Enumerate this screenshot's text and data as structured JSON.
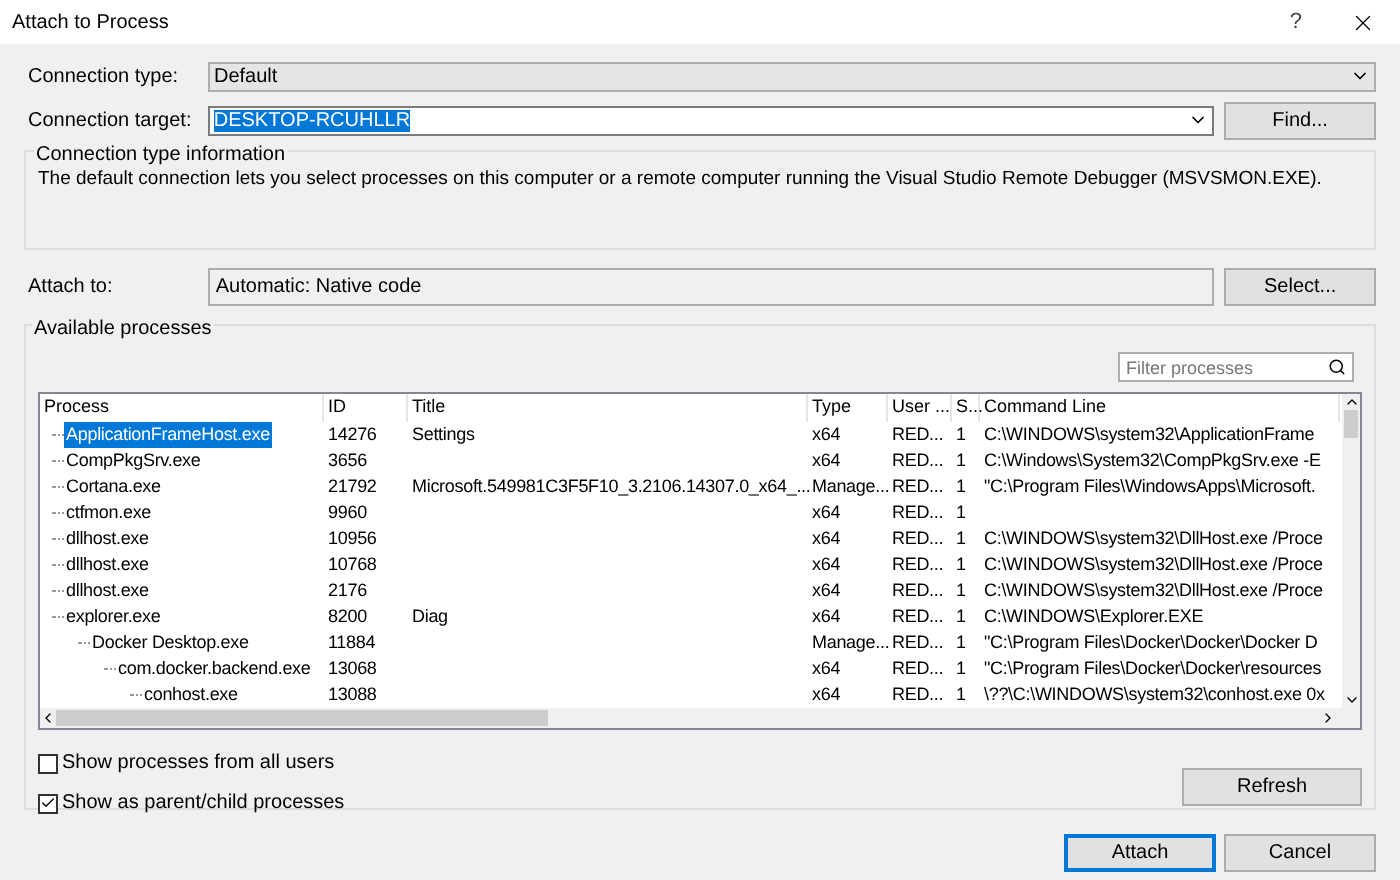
{
  "window": {
    "title": "Attach to Process",
    "help": "?"
  },
  "connection_type": {
    "label": "Connection type:",
    "value": "Default"
  },
  "connection_target": {
    "label": "Connection target:",
    "value": "DESKTOP-RCUHLLR",
    "text_selected": true,
    "button": "Find..."
  },
  "info": {
    "title": "Connection type information",
    "text": "The default connection lets you select processes on this computer or a remote computer running the Visual Studio Remote Debugger (MSVSMON.EXE)."
  },
  "attach_to": {
    "label": "Attach to:",
    "value": "Automatic: Native code",
    "button": "Select..."
  },
  "available": {
    "title": "Available processes",
    "filter_placeholder": "Filter processes",
    "columns": [
      "Process",
      "ID",
      "Title",
      "Type",
      "User ...",
      "S...",
      "Command Line"
    ],
    "rows": [
      {
        "process": "ApplicationFrameHost.exe",
        "id": "14276",
        "title": "Settings",
        "type": "x64",
        "user": "RED...",
        "session": "1",
        "command": "C:\\WINDOWS\\system32\\ApplicationFrame",
        "selected": true
      },
      {
        "process": "CompPkgSrv.exe",
        "id": "3656",
        "type": "x64",
        "user": "RED...",
        "session": "1",
        "command": "C:\\Windows\\System32\\CompPkgSrv.exe -E",
        "selected": false
      },
      {
        "process": "Cortana.exe",
        "id": "21792",
        "title": "Microsoft.549981C3F5F10_3.2106.14307.0_x64_...",
        "type": "Manage...",
        "user": "RED...",
        "session": "1",
        "command": "\"C:\\Program Files\\WindowsApps\\Microsoft.",
        "selected": false
      },
      {
        "process": "ctfmon.exe",
        "id": "9960",
        "type": "x64",
        "user": "RED...",
        "session": "1",
        "selected": false
      },
      {
        "process": "dllhost.exe",
        "id": "10956",
        "type": "x64",
        "user": "RED...",
        "session": "1",
        "command": "C:\\WINDOWS\\system32\\DllHost.exe /Proce",
        "selected": false
      },
      {
        "process": "dllhost.exe",
        "id": "10768",
        "type": "x64",
        "user": "RED...",
        "session": "1",
        "command": "C:\\WINDOWS\\system32\\DllHost.exe /Proce",
        "selected": false
      },
      {
        "process": "dllhost.exe",
        "id": "2176",
        "type": "x64",
        "user": "RED...",
        "session": "1",
        "command": "C:\\WINDOWS\\system32\\DllHost.exe /Proce",
        "selected": false
      },
      {
        "process": "explorer.exe",
        "id": "8200",
        "title": "Diag",
        "type": "x64",
        "user": "RED...",
        "session": "1",
        "command": "C:\\WINDOWS\\Explorer.EXE",
        "selected": false,
        "children": [
          {
            "process": "Docker Desktop.exe",
            "id": "11884",
            "type": "Manage...",
            "user": "RED...",
            "session": "1",
            "command": "\"C:\\Program Files\\Docker\\Docker\\Docker D",
            "selected": false,
            "children": [
              {
                "process": "com.docker.backend.exe",
                "id": "13068",
                "type": "x64",
                "user": "RED...",
                "session": "1",
                "command": "\"C:\\Program Files\\Docker\\Docker\\resources",
                "selected": false,
                "children": [
                  {
                    "process": "conhost.exe",
                    "id": "13088",
                    "type": "x64",
                    "user": "RED...",
                    "session": "1",
                    "command": "\\??\\C:\\WINDOWS\\system32\\conhost.exe 0x",
                    "selected": false
                  }
                ]
              }
            ]
          }
        ]
      }
    ],
    "options": [
      {
        "label": "Show processes from all users",
        "checked": false
      },
      {
        "label": "Show as parent/child processes",
        "checked": true
      }
    ],
    "refresh": "Refresh"
  },
  "buttons": [
    {
      "label": "Attach",
      "default": true
    },
    {
      "label": "Cancel",
      "default": false
    }
  ]
}
